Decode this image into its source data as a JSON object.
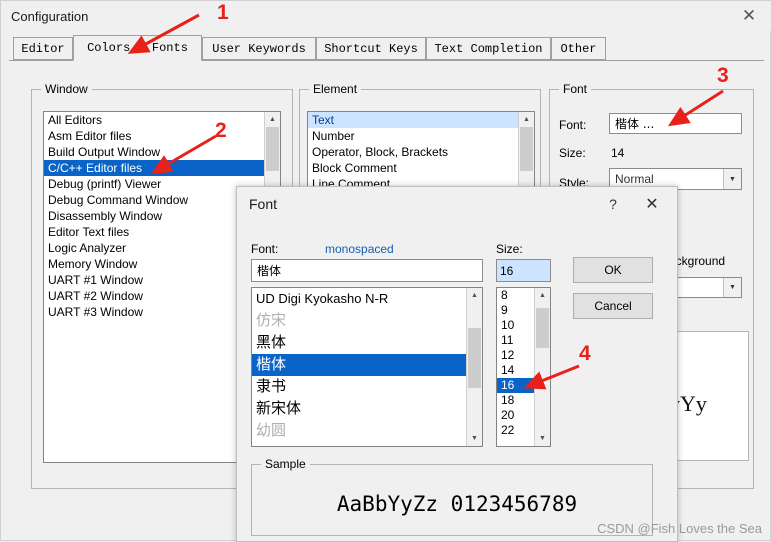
{
  "window": {
    "title": "Configuration",
    "close_icon": "close-icon"
  },
  "tabs": [
    {
      "label": "Editor",
      "active": false
    },
    {
      "label": "Colors & Fonts",
      "active": true
    },
    {
      "label": "User Keywords",
      "active": false
    },
    {
      "label": "Shortcut Keys",
      "active": false
    },
    {
      "label": "Text Completion",
      "active": false
    },
    {
      "label": "Other",
      "active": false
    }
  ],
  "window_group": {
    "label": "Window",
    "items": [
      {
        "text": "All Editors",
        "state": "none"
      },
      {
        "text": "Asm Editor files",
        "state": "none"
      },
      {
        "text": "Build Output Window",
        "state": "none"
      },
      {
        "text": "C/C++ Editor files",
        "state": "selected"
      },
      {
        "text": "Debug (printf) Viewer",
        "state": "none"
      },
      {
        "text": "Debug Command Window",
        "state": "none"
      },
      {
        "text": "Disassembly Window",
        "state": "none"
      },
      {
        "text": "Editor Text files",
        "state": "none"
      },
      {
        "text": "Logic Analyzer",
        "state": "none"
      },
      {
        "text": "Memory Window",
        "state": "none"
      },
      {
        "text": "UART #1 Window",
        "state": "none"
      },
      {
        "text": "UART #2 Window",
        "state": "none"
      },
      {
        "text": "UART #3 Window",
        "state": "none"
      }
    ]
  },
  "element_group": {
    "label": "Element",
    "items": [
      {
        "text": "Text",
        "state": "selected"
      },
      {
        "text": "Number",
        "state": "none"
      },
      {
        "text": "Operator, Block, Brackets",
        "state": "none"
      },
      {
        "text": "Block Comment",
        "state": "none"
      },
      {
        "text": "Line Comment",
        "state": "none"
      }
    ]
  },
  "font_group": {
    "label": "Font",
    "font_label": "Font:",
    "font_value": "楷体 ...",
    "size_label": "Size:",
    "size_value": "14",
    "style_label": "Style:",
    "style_value": "Normal",
    "background_label": "ackground",
    "sample_char": "yYy"
  },
  "dialog": {
    "title": "Font",
    "help_icon": "help-icon",
    "close_icon": "close-icon",
    "font_label": "Font:",
    "font_link": "monospaced",
    "font_value": "楷体",
    "size_label": "Size:",
    "size_value": "16",
    "ok_label": "OK",
    "cancel_label": "Cancel",
    "font_list": [
      {
        "text": "UD Digi Kyokasho N-R",
        "state": "none"
      },
      {
        "text": "仿宋",
        "state": "gray"
      },
      {
        "text": "黑体",
        "state": "none"
      },
      {
        "text": "楷体",
        "state": "selected"
      },
      {
        "text": "隶书",
        "state": "none"
      },
      {
        "text": "新宋体",
        "state": "none"
      },
      {
        "text": "幼圆",
        "state": "gray"
      }
    ],
    "size_list": [
      {
        "text": "8",
        "state": "none"
      },
      {
        "text": "9",
        "state": "none"
      },
      {
        "text": "10",
        "state": "none"
      },
      {
        "text": "11",
        "state": "none"
      },
      {
        "text": "12",
        "state": "none"
      },
      {
        "text": "14",
        "state": "none"
      },
      {
        "text": "16",
        "state": "selected"
      },
      {
        "text": "18",
        "state": "none"
      },
      {
        "text": "20",
        "state": "none"
      },
      {
        "text": "22",
        "state": "none"
      }
    ],
    "sample_label": "Sample",
    "sample_text": "AaBbYyZz 0123456789"
  },
  "annotations": [
    {
      "number": "1"
    },
    {
      "number": "2"
    },
    {
      "number": "3"
    },
    {
      "number": "4"
    }
  ],
  "watermark": "CSDN @Fish Loves the Sea",
  "colors": {
    "accent": "#0a64c8",
    "annotation": "#e8221b",
    "link": "#1560b0"
  }
}
